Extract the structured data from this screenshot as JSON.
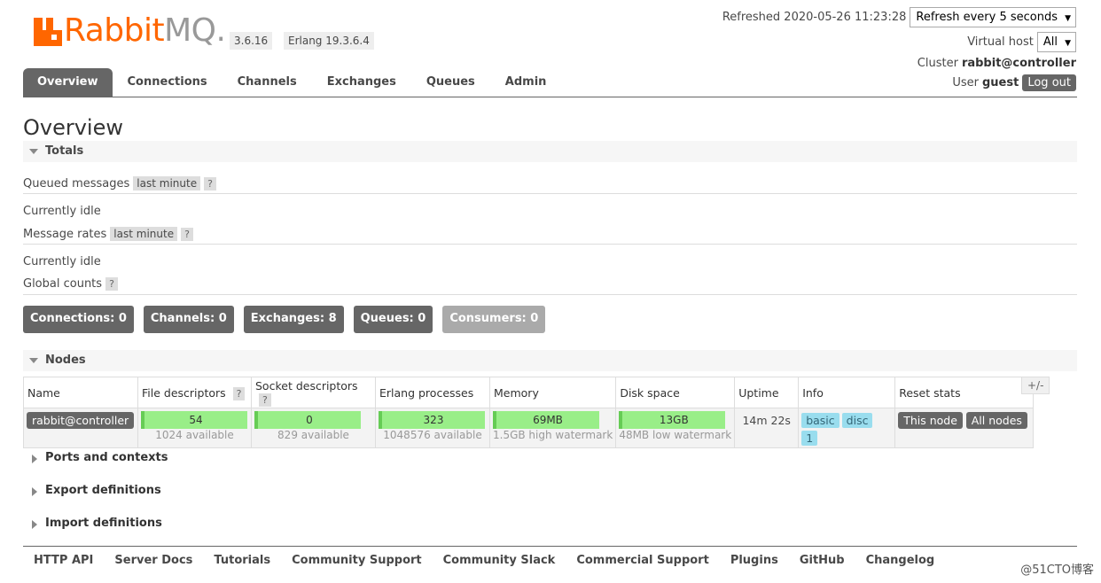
{
  "logo": {
    "rabbit": "Rabbit",
    "mq": "MQ."
  },
  "versions": {
    "rabbitmq": "3.6.16",
    "erlang": "Erlang 19.3.6.4"
  },
  "header": {
    "refreshed": "Refreshed 2020-05-26 11:23:28",
    "refresh_select": "Refresh every 5 seconds",
    "vhost_label": "Virtual host",
    "vhost_select": "All",
    "cluster_label": "Cluster",
    "cluster_name": "rabbit@controller",
    "user_label": "User",
    "user_name": "guest",
    "logout": "Log out"
  },
  "tabs": [
    {
      "label": "Overview",
      "active": true
    },
    {
      "label": "Connections"
    },
    {
      "label": "Channels"
    },
    {
      "label": "Exchanges"
    },
    {
      "label": "Queues"
    },
    {
      "label": "Admin"
    }
  ],
  "page_title": "Overview",
  "totals": {
    "heading": "Totals",
    "queued_label": "Queued messages",
    "queued_tag": "last minute",
    "help": "?",
    "idle1": "Currently idle",
    "rates_label": "Message rates",
    "rates_tag": "last minute",
    "idle2": "Currently idle",
    "global_label": "Global counts"
  },
  "counts": [
    {
      "label": "Connections: 0"
    },
    {
      "label": "Channels: 0"
    },
    {
      "label": "Exchanges: 8"
    },
    {
      "label": "Queues: 0"
    },
    {
      "label": "Consumers: 0"
    }
  ],
  "nodes": {
    "heading": "Nodes",
    "plusminus": "+/-",
    "headers": [
      "Name",
      "File descriptors",
      "Socket descriptors",
      "Erlang processes",
      "Memory",
      "Disk space",
      "Uptime",
      "Info",
      "Reset stats"
    ],
    "row": {
      "name": "rabbit@controller",
      "fd": "54",
      "fd_sub": "1024 available",
      "sd": "0",
      "sd_sub": "829 available",
      "ep": "323",
      "ep_sub": "1048576 available",
      "mem": "69MB",
      "mem_sub": "1.5GB high watermark",
      "disk": "13GB",
      "disk_sub": "48MB low watermark",
      "uptime": "14m 22s",
      "info": [
        "basic",
        "disc",
        "1"
      ],
      "reset_this": "This node",
      "reset_all": "All nodes"
    }
  },
  "collapsed": [
    "Ports and contexts",
    "Export definitions",
    "Import definitions"
  ],
  "footer": [
    "HTTP API",
    "Server Docs",
    "Tutorials",
    "Community Support",
    "Community Slack",
    "Commercial Support",
    "Plugins",
    "GitHub",
    "Changelog"
  ],
  "watermark": "@51CTO博客"
}
